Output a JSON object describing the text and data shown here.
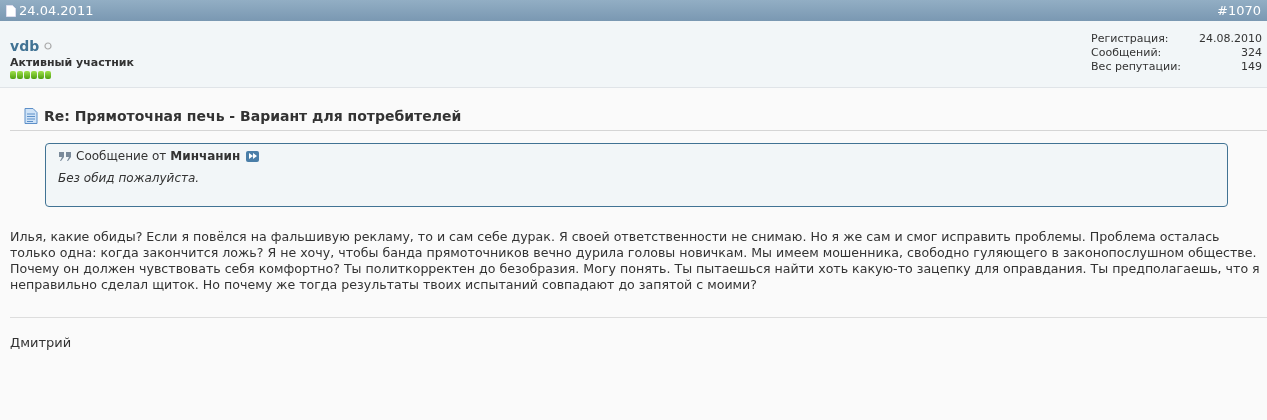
{
  "post_header": {
    "date": "24.04.2011",
    "number": "#1070"
  },
  "user": {
    "name": "vdb",
    "online": false,
    "rank": "Активный участник",
    "reputation": {
      "stars": 6
    }
  },
  "user_stats": [
    {
      "label": "Регистрация:",
      "value": "24.08.2010"
    },
    {
      "label": "Сообщений:",
      "value": "324"
    },
    {
      "label": "Вес репутации:",
      "value": "149"
    }
  ],
  "post": {
    "title": "Re: Прямоточная печь - Вариант для потребителей",
    "quote": {
      "prefix": "Сообщение от",
      "author": "Минчанин",
      "text": "Без обид пожалуйста."
    },
    "message": "Илья, какие обиды? Если я повёлся на фальшивую рекламу, то и сам себе дурак. Я своей ответственности не снимаю. Но я же сам и смог исправить проблемы. Проблема осталась только одна: когда закончится ложь? Я не хочу, чтобы банда прямоточников вечно дурила головы новичкам. Мы имеем мошенника, свободно гуляющего в законопослушном обществе. Почему он должен чувствовать себя комфортно? Ты политкорректен до безобразия. Могу понять. Ты пытаешься найти хоть какую-то зацепку для оправдания. Ты предполагаешь, что я неправильно сделал щиток. Но почему же тогда результаты твоих испытаний совпадают до запятой с моими?",
    "signature": "Дмитрий"
  }
}
